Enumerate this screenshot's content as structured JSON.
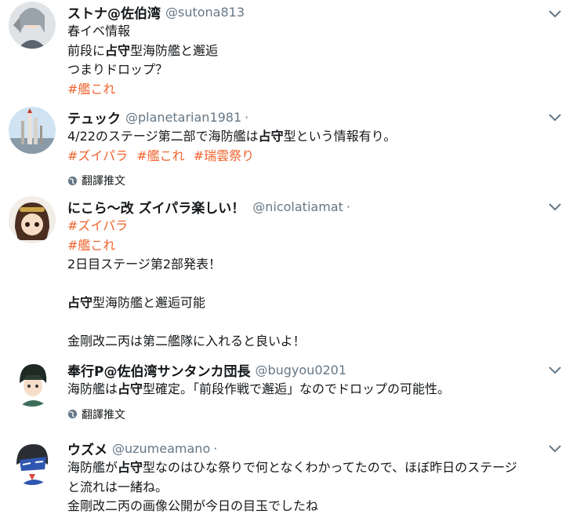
{
  "colors": {
    "hashtag": "#f0642e",
    "secondary_text": "#657786",
    "text": "#14171a"
  },
  "tweets": [
    {
      "display_name": "ストナ@佐伯湾",
      "handle": "@sutona813",
      "lines": [
        "春イベ情報",
        "前段に",
        "占守",
        "型海防艦と邂逅",
        "つまりドロップ？"
      ],
      "hashtags": [
        "#艦これ"
      ]
    },
    {
      "display_name": "テュック",
      "handle": "@planetarian1981",
      "dot": "·",
      "text_pre": "4/22のステージ第二部で海防艦は",
      "text_strong": "占守",
      "text_post": "型という情報有り。",
      "hashtags": [
        "#ズイパラ",
        "#艦これ",
        "#瑞雲祭り"
      ],
      "translate": "翻譯推文"
    },
    {
      "display_name": "にこら〜改 ズイパラ楽しい！",
      "handle": "@nicolatiamat",
      "dot": "·",
      "hashtags": [
        "#ズイパラ",
        "#艦これ"
      ],
      "line1": "2日目ステージ第2部発表！",
      "line2_strong": "占守",
      "line2_post": "型海防艦と邂逅可能",
      "line3": "金剛改二丙は第二艦隊に入れると良いよ！"
    },
    {
      "display_name": "奉行P@佐伯湾サンタンカ団長",
      "handle": "@bugyou0201",
      "text_pre": "海防艦は",
      "text_strong": "占守",
      "text_post": "型確定。「前段作戦で邂逅」なのでドロップの可能性。",
      "translate": "翻譯推文"
    },
    {
      "display_name": "ウズメ",
      "handle": "@uzumeamano",
      "dot": "·",
      "line1_pre": "海防艦が",
      "line1_strong": "占守",
      "line1_post": "型なのはひな祭りで何となくわかってたので、ほぼ昨日のステージ",
      "line2": "と流れは一緒ね。",
      "line3": "金剛改二丙の画像公開が今日の目玉でしたね"
    }
  ],
  "icons": {
    "caret": "chevron-down-icon",
    "translate": "globe-icon"
  }
}
